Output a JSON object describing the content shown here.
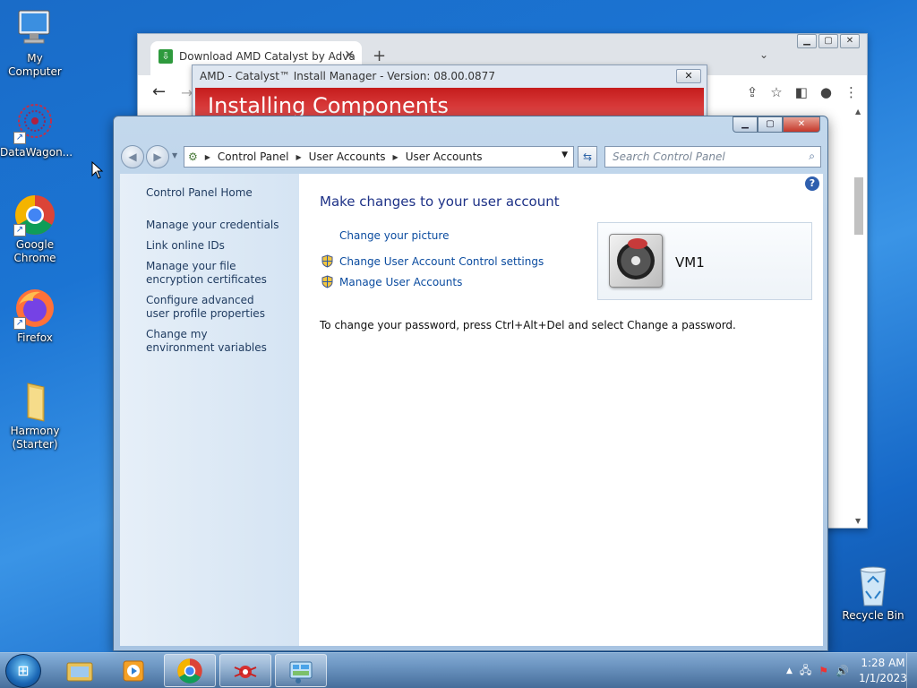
{
  "desktop": {
    "icons": [
      {
        "label": "My Computer"
      },
      {
        "label": "DataWagon..."
      },
      {
        "label": "Google Chrome"
      },
      {
        "label": "Firefox"
      },
      {
        "label": "Harmony (Starter)"
      },
      {
        "label": "Recycle Bin"
      }
    ]
  },
  "chrome": {
    "tab_title": "Download AMD Catalyst by Adva",
    "new_tab": "+",
    "close_tab": "✕"
  },
  "amd": {
    "title": "AMD - Catalyst™ Install Manager - Version: 08.00.0877",
    "banner": "Installing Components"
  },
  "cp": {
    "breadcrumb": [
      "Control Panel",
      "User Accounts",
      "User Accounts"
    ],
    "search_placeholder": "Search Control Panel",
    "sidebar": [
      "Control Panel Home",
      "Manage your credentials",
      "Link online IDs",
      "Manage your file encryption certificates",
      "Configure advanced user profile properties",
      "Change my environment variables"
    ],
    "heading": "Make changes to your user account",
    "links": [
      "Change your picture",
      "Change User Account Control settings",
      "Manage User Accounts"
    ],
    "username": "VM1",
    "password_note": "To change your password, press Ctrl+Alt+Del and select Change a password."
  },
  "taskbar": {
    "time": "1:28 AM",
    "date": "1/1/2023"
  }
}
